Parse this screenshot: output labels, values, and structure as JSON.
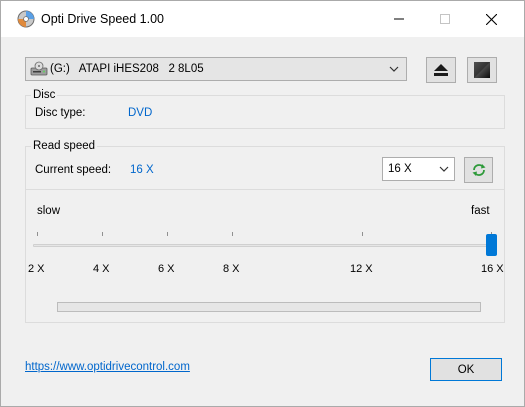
{
  "window": {
    "title": "Opti Drive Speed 1.00"
  },
  "drive": {
    "selected": "(G:)   ATAPI iHES208   2 8L05"
  },
  "disc": {
    "group_title": "Disc",
    "type_label": "Disc type:",
    "type_value": "DVD"
  },
  "read": {
    "group_title": "Read speed",
    "current_label": "Current speed:",
    "current_value": "16 X",
    "selected_speed": "16 X"
  },
  "slider": {
    "slow_label": "slow",
    "fast_label": "fast",
    "ticks": [
      "2 X",
      "4 X",
      "6 X",
      "8 X",
      "12 X",
      "16 X"
    ],
    "selected_index": 5
  },
  "progress": {
    "value": 0
  },
  "footer": {
    "link": "https://www.optidrivecontrol.com",
    "ok_label": "OK"
  },
  "colors": {
    "accent": "#0078d7",
    "value_text": "#0066cc"
  },
  "icons": [
    "disc-app-icon",
    "minimize-icon",
    "maximize-icon",
    "close-icon",
    "drive-icon",
    "chevron-down-icon",
    "eject-icon",
    "disc-info-icon",
    "refresh-icon"
  ]
}
